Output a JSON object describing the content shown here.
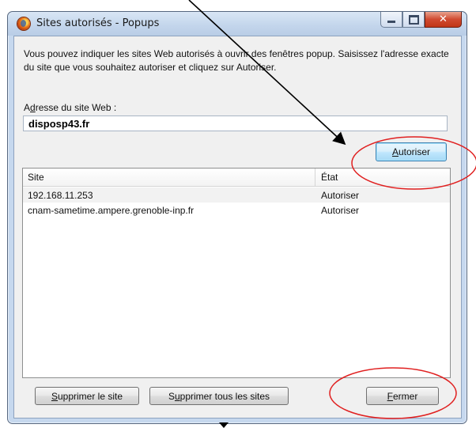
{
  "window": {
    "title": "Sites autorisés - Popups",
    "close_glyph": "✕"
  },
  "description": "Vous pouvez indiquer les sites Web autorisés à ouvrir des fenêtres popup. Saisissez l'adresse exacte du site que vous souhaitez autoriser et cliquez sur Autoriser.",
  "address": {
    "label_first": "A",
    "label_underline": "d",
    "label_rest": "resse du site Web :",
    "value": "disposp43.fr"
  },
  "buttons": {
    "authorize_key": "A",
    "authorize_rest": "utoriser",
    "remove_site_key": "S",
    "remove_site_rest": "upprimer le site",
    "remove_all_first": "S",
    "remove_all_key": "u",
    "remove_all_rest": "pprimer tous les sites",
    "close_key": "F",
    "close_rest": "ermer"
  },
  "table": {
    "columns": [
      "Site",
      "État"
    ],
    "rows": [
      {
        "site": "192.168.11.253",
        "state": "Autoriser"
      },
      {
        "site": "cnam-sametime.ampere.grenoble-inp.fr",
        "state": "Autoriser"
      }
    ]
  },
  "colors": {
    "annotation": "#e02020",
    "arrow": "#000000",
    "focus_button": "#3c7fb1"
  },
  "icons": [
    "firefox-icon",
    "minimize-icon",
    "maximize-icon",
    "close-icon"
  ]
}
